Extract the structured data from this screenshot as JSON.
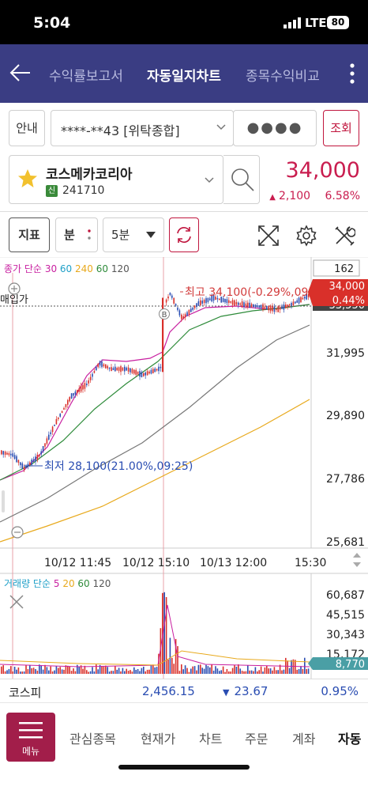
{
  "status_bar": {
    "time": "5:04",
    "network": "LTE",
    "battery": "80"
  },
  "header": {
    "tabs": [
      {
        "label": "수익률보고서",
        "active": false
      },
      {
        "label": "자동일지차트",
        "active": true
      },
      {
        "label": "종목수익비교",
        "active": false
      }
    ]
  },
  "account": {
    "guide_label": "안내",
    "account_number": "****-**43 [위탁종합]",
    "password_mask": "●●●●",
    "query_label": "조회"
  },
  "stock": {
    "name": "코스메카코리아",
    "badge": "신",
    "code": "241710",
    "price": "34,000",
    "change": "2,100",
    "change_pct": "6.58%"
  },
  "toolbar": {
    "indicator_label": "지표",
    "minute_label": "분",
    "interval_label": "5분"
  },
  "chart_header": {
    "ma_prefix": "종가 단순",
    "ma_30": "30",
    "ma_60": "60",
    "ma_240": "240",
    "ma_60b": "60",
    "ma_120": "120",
    "count_box": "162"
  },
  "chart_data": {
    "type": "candlestick",
    "y_ticks": [
      "31,995",
      "29,890",
      "27,786",
      "25,681"
    ],
    "current_price_tag": "34,000",
    "current_pct_tag": "0.44%",
    "avg_price_tag": "33,550",
    "avg_label": "매입가",
    "high_annotation": "최고 34,100(-0.29%,09",
    "low_annotation": "최저 28,100(21.00%,09:25)",
    "buy_marker": "B",
    "x_ticks": [
      "10/12 11:45",
      "10/12 15:10",
      "10/13 12:00",
      "15:30"
    ],
    "ma_colors": {
      "ma30": "#c81fa0",
      "ma60": "#2e8b3a",
      "ma240": "#e8a91c",
      "ma120": "#777777"
    }
  },
  "volume": {
    "prefix": "거래량 단순",
    "ma_5": "5",
    "ma_20": "20",
    "ma_60": "60",
    "ma_120": "120",
    "y_ticks": [
      "60,687",
      "45,515",
      "30,343",
      "15,172"
    ],
    "current_tag": "8,770"
  },
  "kospi": {
    "label": "코스피",
    "value": "2,456.15",
    "change": "23.67",
    "pct": "0.95%"
  },
  "bottom_nav": {
    "menu_label": "메뉴",
    "items": [
      "관심종목",
      "현재가",
      "차트",
      "주문",
      "계좌",
      "자동"
    ]
  }
}
